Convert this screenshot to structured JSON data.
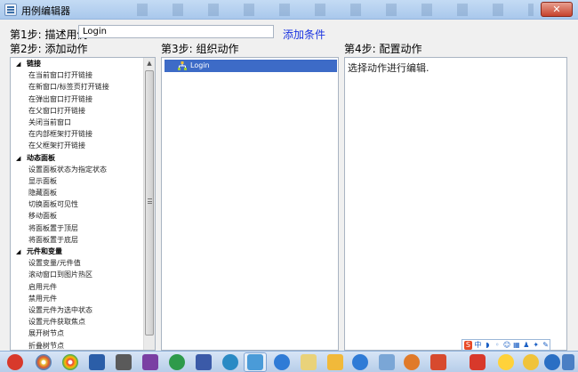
{
  "window": {
    "title": "用例编辑器",
    "close_label": "✕"
  },
  "step1": {
    "label": "第1步: 描述用例",
    "input_value": "Login",
    "add_condition_link": "添加条件"
  },
  "step2": {
    "label": "第2步: 添加动作",
    "groups": [
      {
        "label": "链接",
        "items": [
          "在当前窗口打开链接",
          "在新窗口/标签页打开链接",
          "在弹出窗口打开链接",
          "在父窗口打开链接",
          "关闭当前窗口",
          "在内部框架打开链接",
          "在父框架打开链接"
        ]
      },
      {
        "label": "动态面板",
        "items": [
          "设置面板状态为指定状态",
          "显示面板",
          "隐藏面板",
          "切换面板可见性",
          "移动面板",
          "将面板置于顶层",
          "将面板置于底层"
        ]
      },
      {
        "label": "元件和变量",
        "items": [
          "设置变量/元件值",
          "滚动窗口到图片热区",
          "启用元件",
          "禁用元件",
          "设置元件为选中状态",
          "设置元件获取焦点",
          "展开树节点",
          "折叠树节点"
        ]
      }
    ]
  },
  "step3": {
    "label": "第3步: 组织动作",
    "case_name": "Login"
  },
  "step4": {
    "label": "第4步: 配置动作",
    "hint": "选择动作进行编辑."
  },
  "colors": {
    "selection": "#3d6bc7",
    "link": "#1a33e0",
    "close_button": "#c7432d"
  }
}
